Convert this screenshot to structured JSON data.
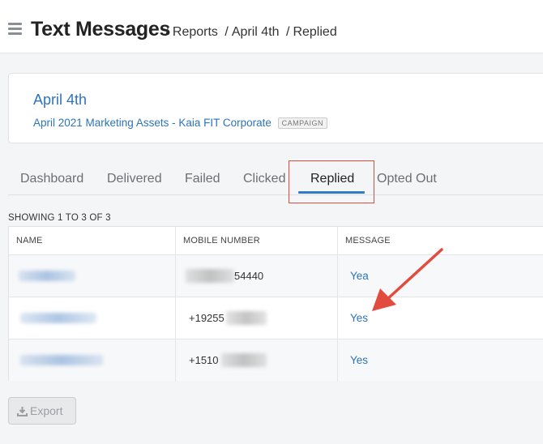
{
  "header": {
    "title": "Text Messages",
    "breadcrumb": [
      "Reports",
      "April 4th",
      "Replied"
    ],
    "separator": "/"
  },
  "campaign": {
    "title": "April 4th",
    "subtitle": "April 2021 Marketing Assets - Kaia FIT Corporate",
    "badge": "CAMPAIGN"
  },
  "tabs": [
    {
      "label": "Dashboard",
      "active": false
    },
    {
      "label": "Delivered",
      "active": false
    },
    {
      "label": "Failed",
      "active": false
    },
    {
      "label": "Clicked",
      "active": false
    },
    {
      "label": "Replied",
      "active": true
    },
    {
      "label": "Opted Out",
      "active": false
    }
  ],
  "table": {
    "showing": "SHOWING 1 TO 3 OF 3",
    "columns": [
      "NAME",
      "MOBILE NUMBER",
      "MESSAGE"
    ],
    "rows": [
      {
        "mobile_visible": "54440",
        "message": "Yea"
      },
      {
        "mobile_visible": "+19255",
        "message": "Yes"
      },
      {
        "mobile_visible": "+1510",
        "message": "Yes"
      }
    ]
  },
  "export": {
    "label": "Export",
    "icon": "download-icon"
  },
  "colors": {
    "accent": "#2f7dc4",
    "link": "#2d74b8",
    "annotation": "#e24c3f"
  }
}
